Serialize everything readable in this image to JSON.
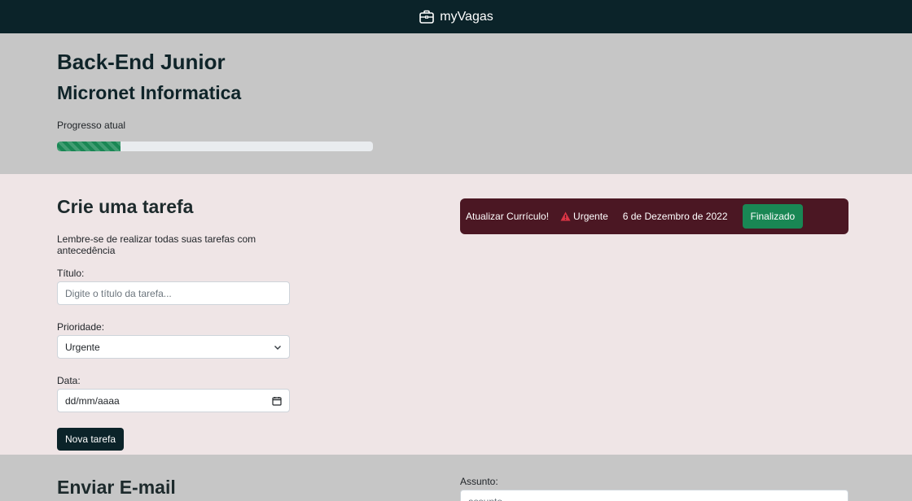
{
  "navbar": {
    "brand": "myVagas",
    "icon": "briefcase-icon"
  },
  "job": {
    "title": "Back-End Junior",
    "company": "Micronet Informatica",
    "progress_label": "Progresso atual",
    "progress_value": 0.2
  },
  "task_form": {
    "heading": "Crie uma tarefa",
    "hint": "Lembre-se de realizar todas suas tarefas com antecedência",
    "title_label": "Título:",
    "title_placeholder": "Digite o título da tarefa...",
    "priority_label": "Prioridade:",
    "priority_value": "Urgente",
    "date_label": "Data:",
    "date_value": "dd/mm/aaaa",
    "submit_label": "Nova tarefa"
  },
  "tasks": [
    {
      "title": "Atualizar Currículo!",
      "priority": "Urgente",
      "priority_icon": "warning-icon",
      "date": "6 de Dezembro de 2022",
      "status_button": "Finalizado"
    }
  ],
  "email_form": {
    "heading": "Enviar E-mail",
    "subject_label": "Assunto:",
    "subject_placeholder": "assunto"
  },
  "colors": {
    "navbar": "#0b2329",
    "task_card": "#4b1723",
    "success": "#198754",
    "warning": "#dc3545"
  }
}
